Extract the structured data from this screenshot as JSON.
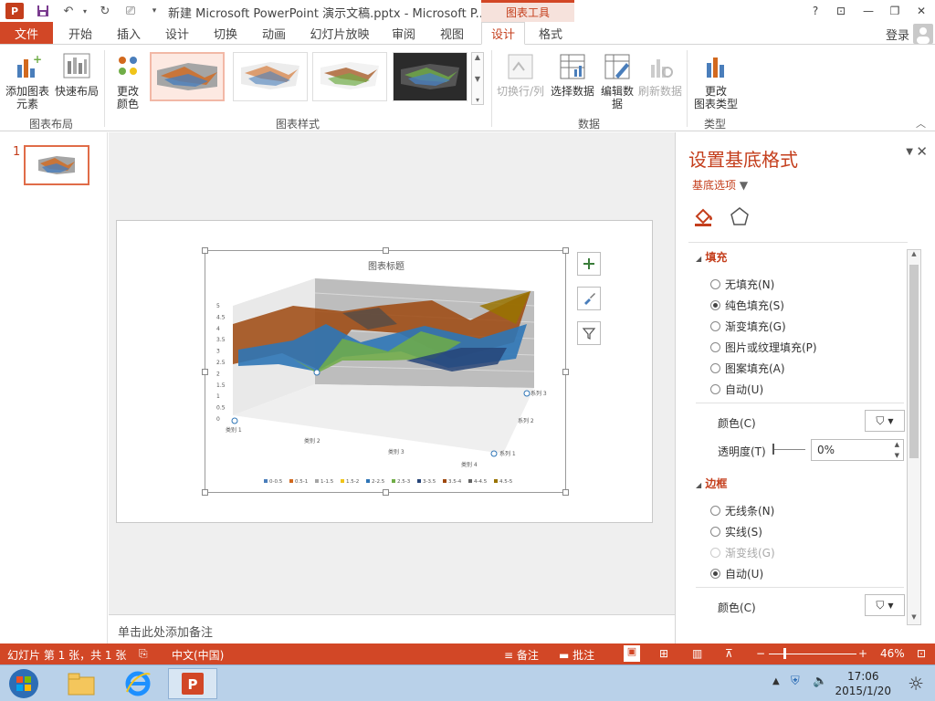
{
  "titlebar": {
    "app_logo": "P",
    "title": "新建 Microsoft PowerPoint 演示文稿.pptx - Microsoft P...",
    "tool_context": "图表工具",
    "help": "?",
    "restore_ribbon": "⊡",
    "minimize": "—",
    "maximize": "❐",
    "close": "✕"
  },
  "tabs": [
    "文件",
    "开始",
    "插入",
    "设计",
    "切换",
    "动画",
    "幻灯片放映",
    "审阅",
    "视图",
    "设计",
    "格式"
  ],
  "login": "登录",
  "ribbon": {
    "add_chart_element": [
      "添加图表",
      "元素"
    ],
    "quick_layout": "快速布局",
    "group_chart_layout": "图表布局",
    "change_colors": [
      "更改",
      "颜色"
    ],
    "group_chart_styles": "图表样式",
    "switch_row_col": "切换行/列",
    "select_data": "选择数据",
    "edit_data": [
      "编辑数",
      "据"
    ],
    "refresh_data": "刷新数据",
    "group_data": "数据",
    "change_chart_type": [
      "更改",
      "图表类型"
    ],
    "group_type": "类型"
  },
  "slides_pane": {
    "slide_number": "1"
  },
  "chart": {
    "title": "图表标题",
    "y_ticks": [
      "0",
      "0.5",
      "1",
      "1.5",
      "2",
      "2.5",
      "3",
      "3.5",
      "4",
      "4.5",
      "5"
    ],
    "categories": [
      "类别 1",
      "类别 2",
      "类别 3",
      "类别 4"
    ],
    "series": [
      "系列 1",
      "系列 2",
      "系列 3"
    ],
    "legend": [
      "0-0.5",
      "0.5-1",
      "1-1.5",
      "1.5-2",
      "2-2.5",
      "2.5-3",
      "3-3.5",
      "3.5-4",
      "4-4.5",
      "4.5-5"
    ],
    "legend_colors": [
      "#4a7ebb",
      "#d2691e",
      "#a5a5a5",
      "#f0c419",
      "#2e75b6",
      "#70ad47",
      "#264478",
      "#9e480e",
      "#636363",
      "#997300"
    ]
  },
  "notes": "单击此处添加备注",
  "format_panel": {
    "title": "设置基底格式",
    "subtitle": "基底选项",
    "fill_section": "填充",
    "fill_options": [
      "无填充(N)",
      "纯色填充(S)",
      "渐变填充(G)",
      "图片或纹理填充(P)",
      "图案填充(A)",
      "自动(U)"
    ],
    "fill_selected": 1,
    "color_label": "颜色(C)",
    "transparency_label": "透明度(T)",
    "transparency_value": "0%",
    "border_section": "边框",
    "border_options": [
      "无线条(N)",
      "实线(S)",
      "渐变线(G)",
      "自动(U)"
    ],
    "border_selected": 3,
    "border_color_label": "颜色(C)"
  },
  "statusbar": {
    "slide_info": "幻灯片 第 1 张，共 1 张",
    "language": "中文(中国)",
    "notes": "备注",
    "comments": "批注",
    "zoom": "46%"
  },
  "taskbar": {
    "time": "17:06",
    "date": "2015/1/20"
  }
}
